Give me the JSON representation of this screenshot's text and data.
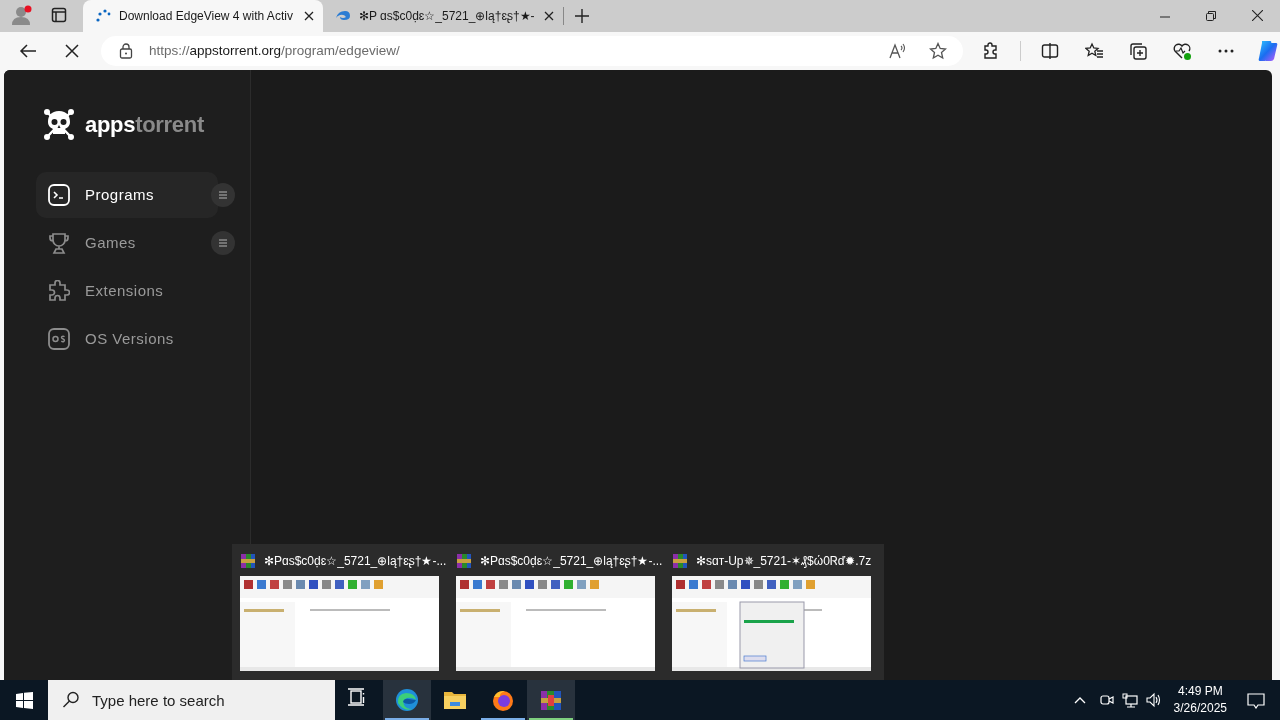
{
  "browser": {
    "tabs": [
      {
        "title": "Download EdgeView 4 with Activ",
        "kind": "spinner",
        "selected": true
      },
      {
        "title": "✻P ɑs$c0ḍɛ☆_5721_⊕lą†ɛʂ†★-",
        "kind": "edge",
        "selected": false
      }
    ],
    "loading": true,
    "address": {
      "scheme": "https://",
      "host": "appstorrent.org",
      "path": "/program/edgeview/"
    }
  },
  "site": {
    "logo": {
      "first": "apps",
      "second": "torrent"
    },
    "nav": [
      {
        "label": "Programs",
        "kind": "terminal",
        "selected": true,
        "has_menu": true
      },
      {
        "label": "Games",
        "kind": "trophy",
        "selected": false,
        "has_menu": true
      },
      {
        "label": "Extensions",
        "kind": "puzzle",
        "selected": false,
        "has_menu": false
      },
      {
        "label": "OS Versions",
        "kind": "os",
        "selected": false,
        "has_menu": false
      }
    ]
  },
  "previews": [
    {
      "title": "✻Pɑs$c0ḍɛ☆_5721_⊕lą†ɛʂ†★-...",
      "dialog": false
    },
    {
      "title": "✻Pɑs$c0ḍɛ☆_5721_⊕lą†ɛʂ†★-...",
      "dialog": false
    },
    {
      "title": "✻sɑт-Up✵_5721-✶₰$ώ0Ꮢď✹.7z",
      "dialog": true
    }
  ],
  "taskbar": {
    "search_placeholder": "Type here to search",
    "apps": [
      {
        "kind": "taskview",
        "running": false,
        "highlighted": false
      },
      {
        "kind": "edge",
        "running": true,
        "highlighted": true
      },
      {
        "kind": "explorer",
        "running": false,
        "highlighted": false
      },
      {
        "kind": "firefox",
        "running": true,
        "highlighted": false
      },
      {
        "kind": "winrar",
        "running": true,
        "highlighted": true
      }
    ],
    "time": "4:49 PM",
    "date": "3/26/2025"
  }
}
